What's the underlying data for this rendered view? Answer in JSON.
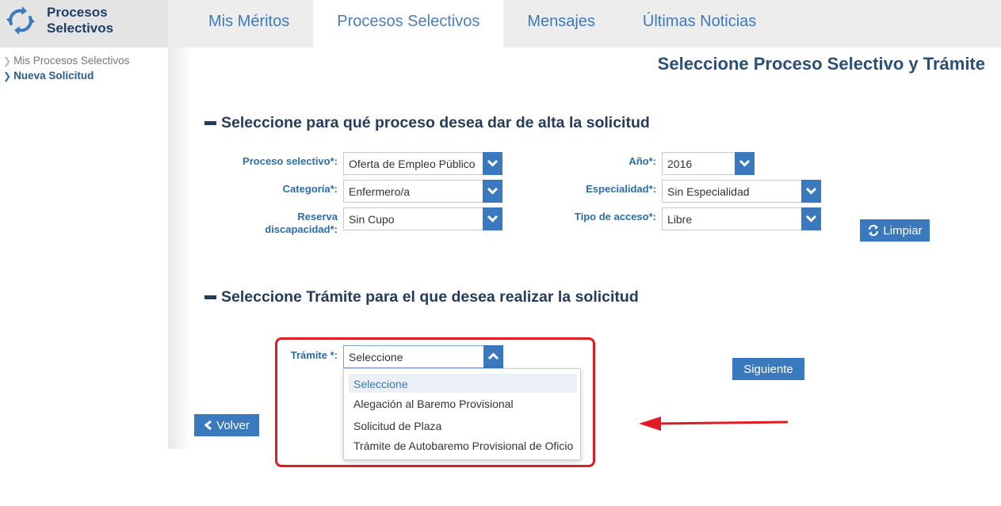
{
  "brand": {
    "title_line1": "Procesos",
    "title_line2": "Selectivos"
  },
  "nav": {
    "tabs": [
      {
        "label": "Mis Méritos"
      },
      {
        "label": "Procesos Selectivos"
      },
      {
        "label": "Mensajes"
      },
      {
        "label": "Últimas Noticias"
      }
    ],
    "active": "Procesos Selectivos"
  },
  "sidebar": {
    "items": [
      {
        "label": "Mis Procesos Selectivos"
      },
      {
        "label": "Nueva Solicitud"
      }
    ]
  },
  "page_title": "Seleccione Proceso Selectivo y Trámite",
  "section1": {
    "title": "Seleccione para qué proceso desea dar de alta la solicitud",
    "fields": {
      "proceso": {
        "label": "Proceso selectivo",
        "req": "*:",
        "value": "Oferta de Empleo Público"
      },
      "anio": {
        "label": "Año",
        "req": "*:",
        "value": "2016"
      },
      "categoria": {
        "label": "Categoría",
        "req": "*:",
        "value": "Enfermero/a"
      },
      "especialidad": {
        "label": "Especialidad",
        "req": "*:",
        "value": "Sin Especialidad"
      },
      "reserva": {
        "label_line1": "Reserva",
        "label_line2": "discapacidad",
        "req": "*:",
        "value": "Sin Cupo"
      },
      "acceso": {
        "label": "Tipo de acceso",
        "req": "*:",
        "value": "Libre"
      }
    },
    "limpiar_label": "Limpiar"
  },
  "section2": {
    "title": "Seleccione Trámite para el que desea realizar la solicitud",
    "tramite": {
      "label": "Trámite",
      "req": " *:",
      "value": "Seleccione",
      "options": [
        "Seleccione",
        "Alegación al Baremo Provisional",
        "Solicitud de Plaza",
        "Trámite de Autobaremo Provisional de Oficio"
      ]
    },
    "siguiente_label": "Siguiente"
  },
  "volver_label": "Volver",
  "colors": {
    "accent": "#3a79bd",
    "highlight": "#e11b22",
    "title": "#2b4f78"
  }
}
